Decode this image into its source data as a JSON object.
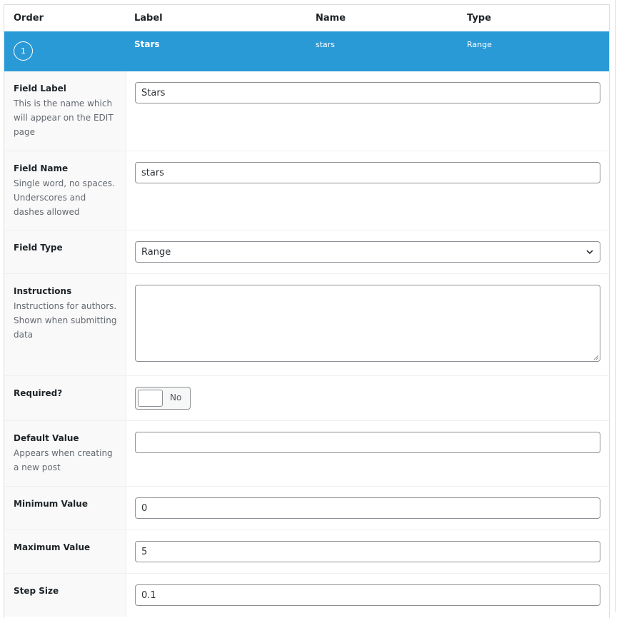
{
  "table_header": {
    "columns": [
      "Order",
      "Label",
      "Name",
      "Type"
    ]
  },
  "field": {
    "order": "1",
    "label": "Stars",
    "name": "stars",
    "type": "Range",
    "accent_color": "#2a9ad6"
  },
  "settings": {
    "field_label": {
      "title": "Field Label",
      "description": "This is the name which will appear on the EDIT page",
      "value": "Stars"
    },
    "field_name": {
      "title": "Field Name",
      "description": "Single word, no spaces. Underscores and dashes allowed",
      "value": "stars"
    },
    "field_type": {
      "title": "Field Type",
      "selected": "Range",
      "icon": "chevron-down-icon"
    },
    "instructions": {
      "title": "Instructions",
      "description": "Instructions for authors. Shown when submitting data",
      "value": ""
    },
    "required": {
      "title": "Required?",
      "toggle_label": "No",
      "checked": false
    },
    "default_value": {
      "title": "Default Value",
      "description": "Appears when creating a new post",
      "value": ""
    },
    "minimum_value": {
      "title": "Minimum Value",
      "value": "0"
    },
    "maximum_value": {
      "title": "Maximum Value",
      "value": "5"
    },
    "step_size": {
      "title": "Step Size",
      "value": "0.1"
    }
  }
}
